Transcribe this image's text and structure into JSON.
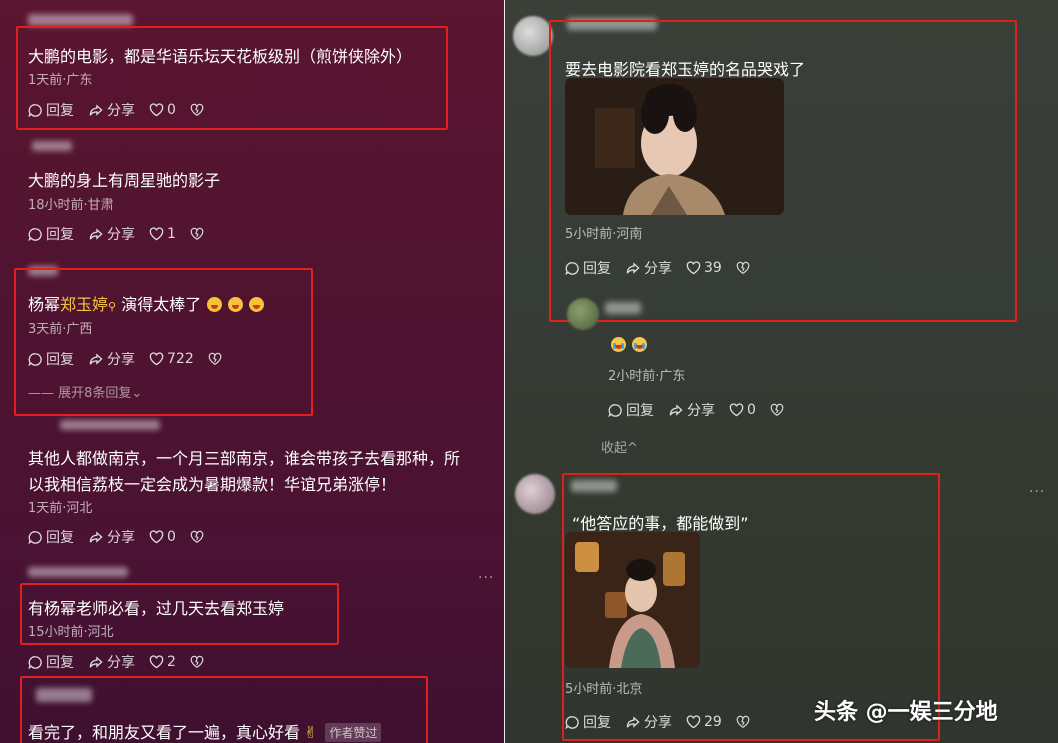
{
  "left_comments": [
    {
      "text": "大鹏的电影，都是华语乐坛天花板级别（煎饼侠除外）",
      "meta": "1天前·广东",
      "likes": "0"
    },
    {
      "text": "大鹏的身上有周星驰的影子",
      "meta": "18小时前·甘肃",
      "likes": "1"
    },
    {
      "text_before": "杨幂",
      "text_highlight": "郑玉婷",
      "text_after": "演得太棒了",
      "meta": "3天前·广西",
      "likes": "722",
      "expand": "展开8条回复"
    },
    {
      "text_line1": "其他人都做南京，一个月三部南京，谁会带孩子去看那种，所",
      "text_line2": "以我相信荔枝一定会成为暑期爆款！华谊兄弟涨停！",
      "meta": "1天前·河北",
      "likes": "0"
    },
    {
      "text": "有杨幂老师必看，过几天去看郑玉婷",
      "meta": "15小时前·河北",
      "likes": "2"
    },
    {
      "text": "看完了，和朋友又看了一遍，真心好看",
      "badge": "作者赞过"
    }
  ],
  "right_comments": [
    {
      "text": "要去电影院看郑玉婷的名品哭戏了",
      "meta": "5小时前·河南",
      "likes": "39"
    },
    {
      "meta": "2小时前·广东",
      "likes": "0",
      "collapse": "收起"
    },
    {
      "text": "“他答应的事，都能做到”",
      "meta": "5小时前·北京",
      "likes": "29"
    }
  ],
  "actions": {
    "reply": "回复",
    "share": "分享"
  },
  "watermark": "头条 @一娱三分地",
  "colors": {
    "highlight_box": "#e0201b",
    "mention": "#f4c542"
  }
}
